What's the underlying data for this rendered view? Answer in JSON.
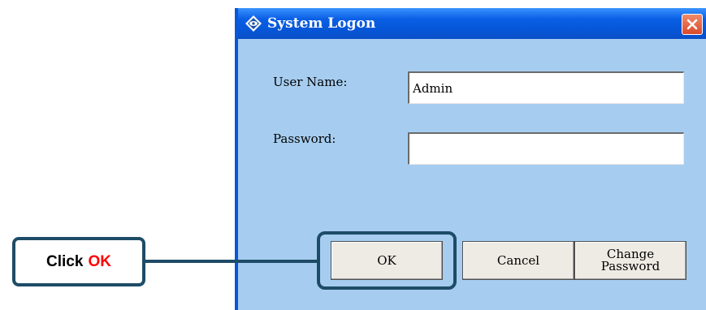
{
  "dialog": {
    "title": "System Logon",
    "title_icon": "diamond-logo-icon",
    "close_icon": "close-x-icon",
    "username_label": "User Name:",
    "username_value": "Admin",
    "password_label": "Password:",
    "password_value": "",
    "buttons": {
      "ok": "OK",
      "cancel": "Cancel",
      "change_line1": "Change",
      "change_line2": "Password"
    }
  },
  "callout": {
    "prefix": "Click",
    "highlight": "OK",
    "highlight_color": "#ff0000",
    "border_color": "#1e4c67"
  },
  "colors": {
    "titlebar": "#0a5fe4",
    "dialog_bg": "#a6cdf0",
    "close_button": "#e05a3a"
  }
}
